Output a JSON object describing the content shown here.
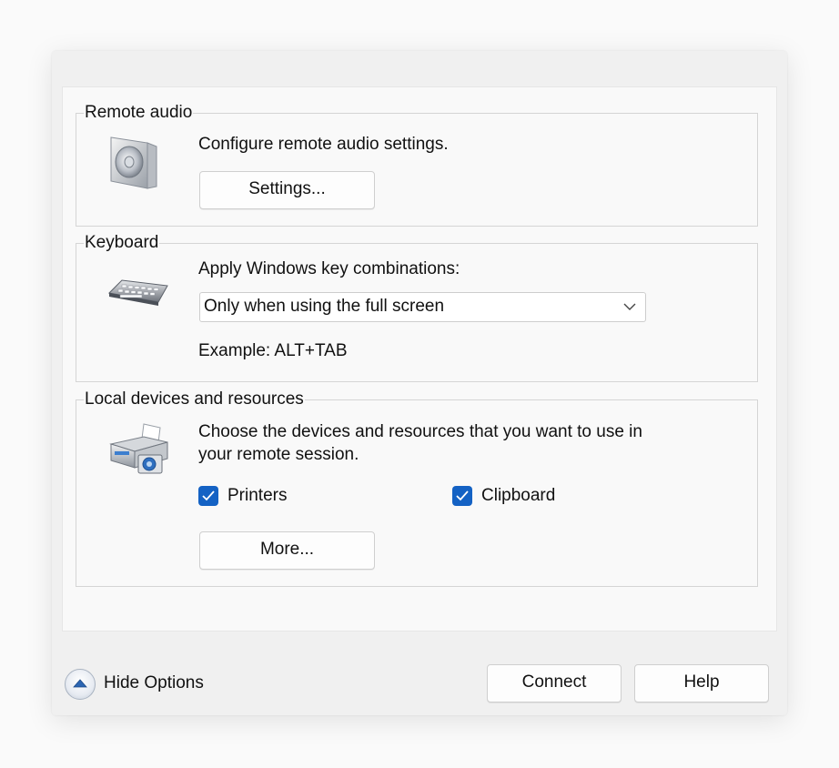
{
  "remote_audio": {
    "title": "Remote audio",
    "description": "Configure remote audio settings.",
    "settings_button": "Settings...",
    "icon": "speaker-icon"
  },
  "keyboard": {
    "title": "Keyboard",
    "label": "Apply Windows key combinations:",
    "selected_option": "Only when using the full screen",
    "example": "Example: ALT+TAB",
    "icon": "keyboard-icon"
  },
  "local_devices": {
    "title": "Local devices and resources",
    "description_line1": "Choose the devices and resources that you want to use in",
    "description_line2": "your remote session.",
    "printers_label": "Printers",
    "printers_checked": true,
    "clipboard_label": "Clipboard",
    "clipboard_checked": true,
    "more_button": "More...",
    "icon": "printer-icon"
  },
  "footer": {
    "hide_options_label": "Hide Options",
    "connect_button": "Connect",
    "help_button": "Help"
  },
  "colors": {
    "checkbox_accent": "#1462c4",
    "window_bg": "#f0f0f0",
    "panel_bg": "#f9f9f9"
  }
}
